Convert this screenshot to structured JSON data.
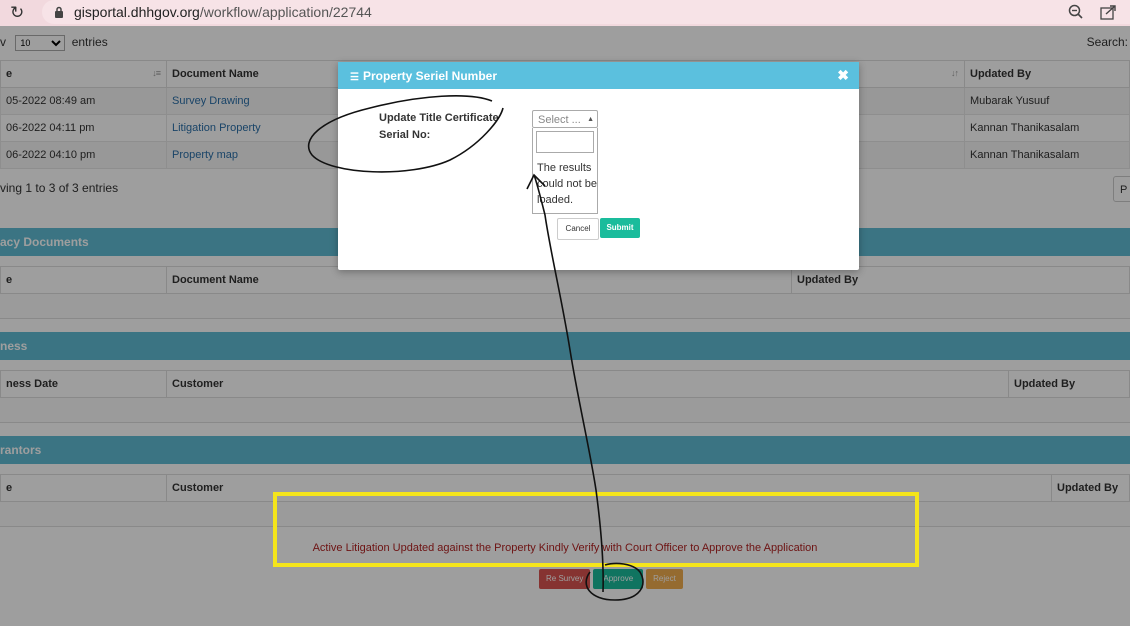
{
  "browser": {
    "url_host": "gisportal.dhhgov.org",
    "url_path": "/workflow/application/22744"
  },
  "table_controls": {
    "show_prefix": "v",
    "page_length": "10",
    "entries_suffix": "entries",
    "search_label": "Search:"
  },
  "documents": {
    "columns": [
      "e",
      "Document Name",
      "Updated By"
    ],
    "rows": [
      {
        "date": "05-2022 08:49 am",
        "name": "Survey Drawing",
        "updated_by": "Mubarak Yusuuf"
      },
      {
        "date": "06-2022 04:11 pm",
        "name": "Litigation Property",
        "updated_by": "Kannan Thanikasalam"
      },
      {
        "date": "06-2022 04:10 pm",
        "name": "Property map",
        "updated_by": "Kannan Thanikasalam"
      }
    ],
    "showing": "ving 1 to 3 of 3 entries",
    "pager": "P"
  },
  "sections": [
    {
      "title": "acy Documents",
      "cols": [
        "e",
        "Document Name",
        "Updated By"
      ]
    },
    {
      "title": "ness",
      "cols": [
        "ness Date",
        "Customer",
        "Updated By"
      ]
    },
    {
      "title": "rantors",
      "cols": [
        "e",
        "Customer",
        "Updated By"
      ]
    }
  ],
  "warning": "Active Litigation Updated against the Property Kindly Verify with Court Officer to Approve the Application",
  "actions": {
    "resurvey": "Re Survey",
    "approve": "Approve",
    "reject": "Reject"
  },
  "modal": {
    "title": "Property Seriel Number",
    "close": "✖",
    "field_label": "Update Title Certificate Serial No:",
    "select_placeholder": "Select ...",
    "dropdown_message": "The results could not be loaded.",
    "cancel": "Cancel",
    "submit": "Submit"
  },
  "colors": {
    "section_bar": "#5fbcd3",
    "modal_header": "#5bc0de",
    "approve": "#1abc9c",
    "resurvey": "#d9534f",
    "reject": "#f0ad4e",
    "highlight_box": "#f5e51b"
  }
}
